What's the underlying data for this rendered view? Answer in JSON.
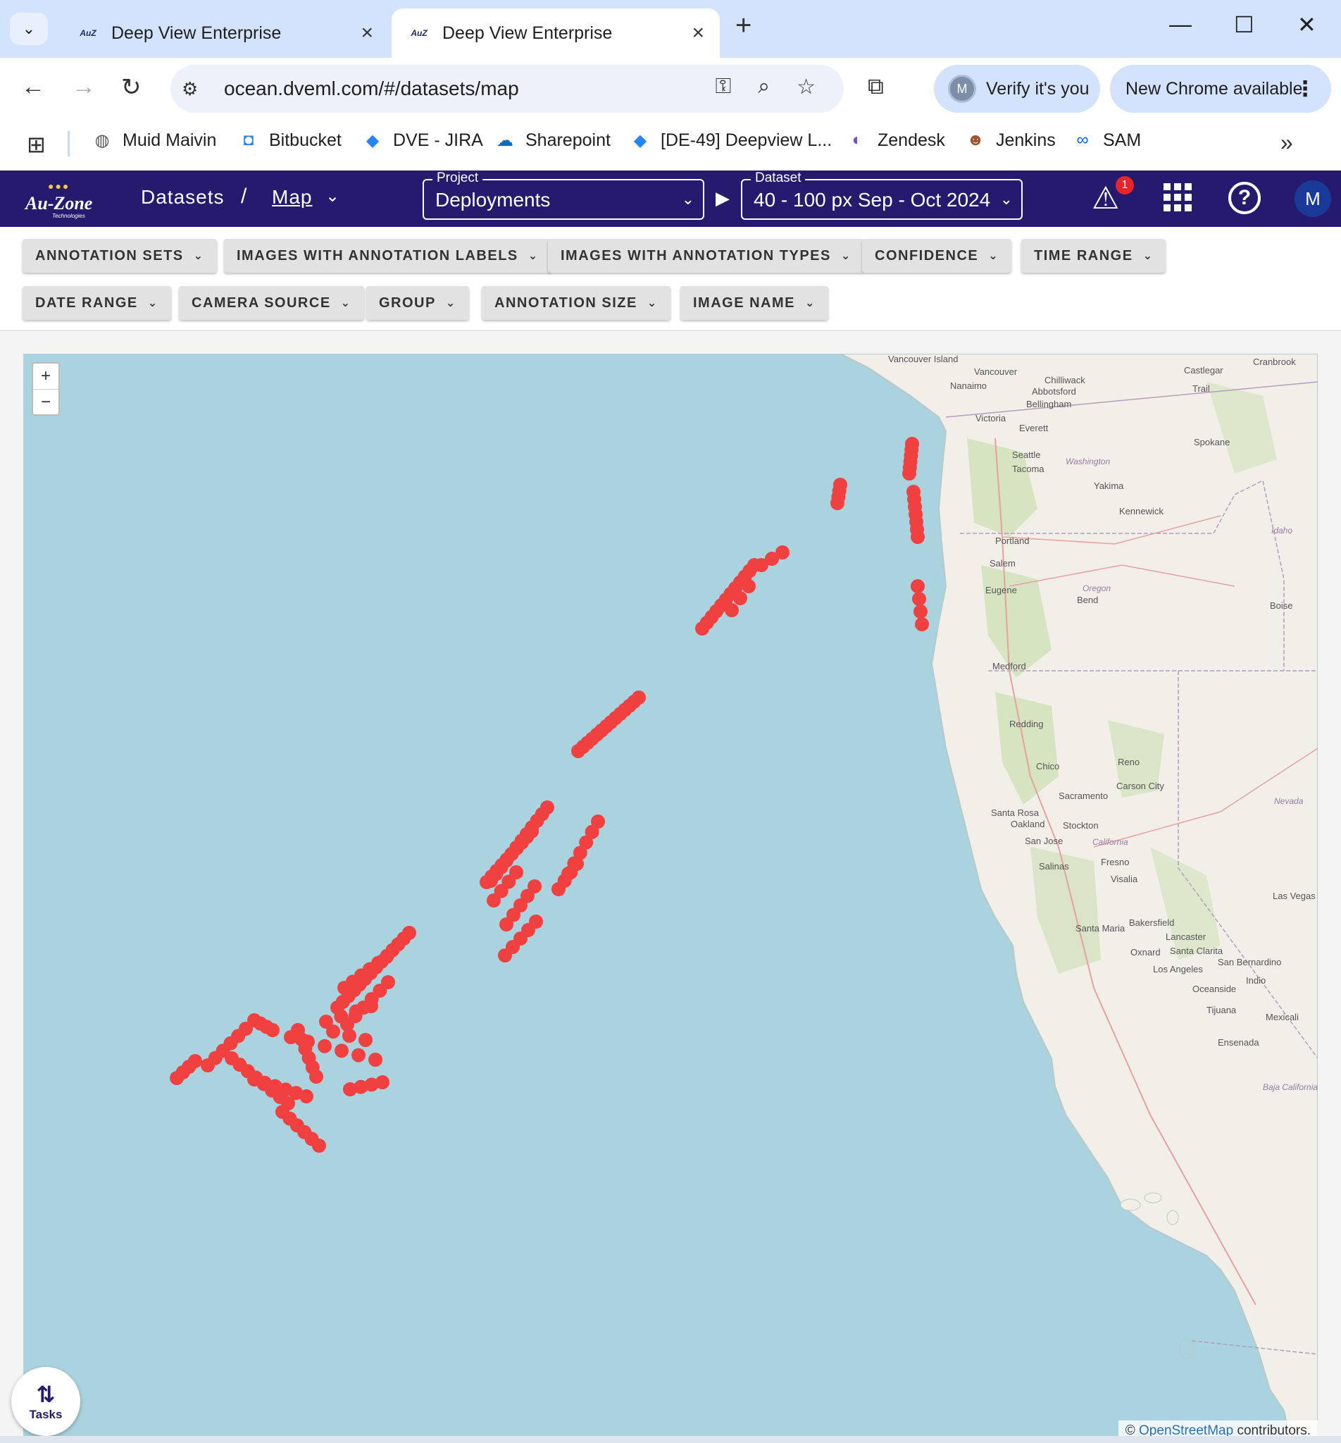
{
  "browser": {
    "tabs": [
      {
        "title": "Deep View Enterprise",
        "active": false
      },
      {
        "title": "Deep View Enterprise",
        "active": true
      }
    ],
    "url": "ocean.dveml.com/#/datasets/map",
    "verify_label": "Verify it's you",
    "verify_avatar": "M",
    "update_label": "New Chrome available",
    "bookmarks": [
      {
        "label": "Muid Maivin",
        "icon": "globe-icon"
      },
      {
        "label": "Bitbucket",
        "icon": "bitbucket-icon"
      },
      {
        "label": "DVE - JIRA",
        "icon": "jira-icon"
      },
      {
        "label": "Sharepoint",
        "icon": "onedrive-icon"
      },
      {
        "label": "[DE-49] Deepview L...",
        "icon": "jira-icon"
      },
      {
        "label": "Zendesk",
        "icon": "zendesk-icon"
      },
      {
        "label": "Jenkins",
        "icon": "jenkins-icon"
      },
      {
        "label": "SAM",
        "icon": "meta-icon"
      }
    ]
  },
  "app": {
    "logo_text": "Au-Zone",
    "logo_sub": "Technologies",
    "breadcrumb": {
      "root": "Datasets",
      "current": "Map"
    },
    "project": {
      "legend": "Project",
      "value": "Deployments"
    },
    "dataset": {
      "legend": "Dataset",
      "value": "40 - 100 px Sep - Oct 2024"
    },
    "alert_count": "1",
    "user_initial": "M",
    "colors": {
      "header": "#261a6e",
      "marker": "#f04040",
      "water": "#aad3df"
    }
  },
  "filters": {
    "row1": [
      "ANNOTATION SETS",
      "IMAGES WITH ANNOTATION LABELS",
      "IMAGES WITH ANNOTATION TYPES",
      "CONFIDENCE",
      "TIME RANGE"
    ],
    "row2": [
      "DATE RANGE",
      "CAMERA SOURCE",
      "GROUP",
      "ANNOTATION SIZE",
      "IMAGE NAME"
    ]
  },
  "map": {
    "zoom_in": "+",
    "zoom_out": "−",
    "attribution_prefix": "© ",
    "attribution_link": "OpenStreetMap",
    "attribution_suffix": " contributors.",
    "cities": [
      "Vancouver Island",
      "Vancouver",
      "Nanaimo",
      "Abbotsford",
      "Chilliwack",
      "Castlegar",
      "Cranbrook",
      "Trail",
      "Bellingham",
      "Victoria",
      "Everett",
      "Seattle",
      "Tacoma",
      "Spokane",
      "Yakima",
      "Kennewick",
      "Portland",
      "Salem",
      "Eugene",
      "Bend",
      "Boise",
      "Medford",
      "Redding",
      "Chico",
      "Reno",
      "Carson City",
      "Sacramento",
      "Santa Rosa",
      "Oakland",
      "Stockton",
      "San Jose",
      "Salinas",
      "Fresno",
      "Visalia",
      "Las Vegas",
      "Bakersfield",
      "Santa Maria",
      "Lancaster",
      "Oxnard",
      "Santa Clarita",
      "San Bernardino",
      "Los Angeles",
      "Indio",
      "Oceanside",
      "Tijuana",
      "Mexicali",
      "Ensenada"
    ],
    "states": [
      "Washington",
      "Idaho",
      "Oregon",
      "California",
      "Nevada",
      "Baja California"
    ]
  },
  "tasks_label": "Tasks"
}
